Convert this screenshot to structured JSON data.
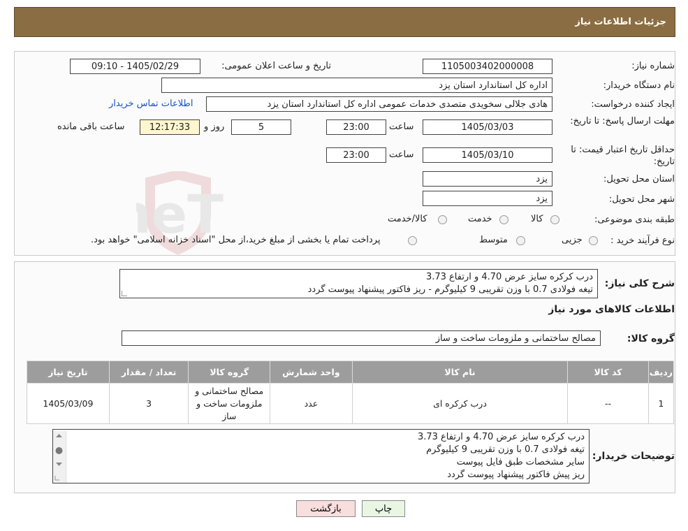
{
  "header": {
    "title": "جزئیات اطلاعات نیاز"
  },
  "form": {
    "need_number_label": "شماره نیاز:",
    "need_number": "1105003402000008",
    "announce_label": "تاریخ و ساعت اعلان عمومی:",
    "announce_value": "1405/02/29 - 09:10",
    "buyer_org_label": "نام دستگاه خریدار:",
    "buyer_org": "اداره کل استاندارد استان یزد",
    "creator_label": "ایجاد کننده درخواست:",
    "creator": "هادی جلالی سخویدی متصدی خدمات عمومی اداره کل استاندارد استان یزد",
    "contact_link": "اطلاعات تماس خریدار",
    "deadline_label": "مهلت ارسال پاسخ: تا تاریخ:",
    "deadline_date": "1405/03/03",
    "time_label": "ساعت",
    "deadline_time": "23:00",
    "days_value": "5",
    "days_label": "روز و",
    "remaining_time": "12:17:33",
    "remaining_label": "ساعت باقی مانده",
    "validity_label": "حداقل تاریخ اعتبار قیمت: تا تاریخ:",
    "validity_date": "1405/03/10",
    "validity_time": "23:00",
    "province_label": "استان محل تحویل:",
    "province": "یزد",
    "city_label": "شهر محل تحویل:",
    "city": "یزد",
    "category_label": "طبقه بندی موضوعی:",
    "category_options": [
      "کالا",
      "خدمت",
      "کالا/خدمت"
    ],
    "process_label": "نوع فرآیند خرید :",
    "process_options": [
      "جزیی",
      "متوسط"
    ],
    "process_note": "پرداخت تمام یا بخشی از مبلغ خرید،از محل \"اسناد خزانه اسلامی\" خواهد بود."
  },
  "watermark": {
    "text": "AriaTender.neT"
  },
  "summary": {
    "label": "شرح کلی نیاز:",
    "lines": [
      "درب کرکره سایز عرض 4.70 و ارتفاع 3.73",
      "تیغه فولادی 0.7 با وزن تقریبی 9 کیلیوگرم - ریز فاکتور پیشنهاد پیوست گردد"
    ],
    "goods_info_title": "اطلاعات کالاهای مورد نیاز",
    "group_label": "گروه کالا:",
    "group_value": "مصالح ساختمانی و ملزومات ساخت و ساز"
  },
  "table": {
    "headers": [
      "ردیف",
      "کد کالا",
      "نام کالا",
      "واحد شمارش",
      "گروه کالا",
      "تعداد / مقدار",
      "تاریخ نیاز"
    ],
    "rows": [
      {
        "row": "1",
        "code": "--",
        "name": "درب کرکره ای",
        "unit": "عدد",
        "group": "مصالح ساختمانی و ملزومات ساخت و ساز",
        "qty": "3",
        "date": "1405/03/09"
      }
    ]
  },
  "buyer_notes": {
    "label": "توضیحات خریدار:",
    "lines": [
      "درب کرکره سایز عرض 4.70 و ارتفاع 3.73",
      "تیغه فولادی 0.7 با وزن تقریبی 9 کیلیوگرم",
      "سایر مشخصات طبق فایل پیوست",
      "ریز پیش فاکتور پیشنهاد پیوست گردد"
    ]
  },
  "buttons": {
    "print": "چاپ",
    "back": "بازگشت"
  },
  "colors": {
    "header_bg": "#8a6d42",
    "table_header_bg": "#9d9d9d",
    "back_button_bg": "#f9dede",
    "print_button_bg": "#e9f6e4",
    "link": "#1a4fd6"
  }
}
